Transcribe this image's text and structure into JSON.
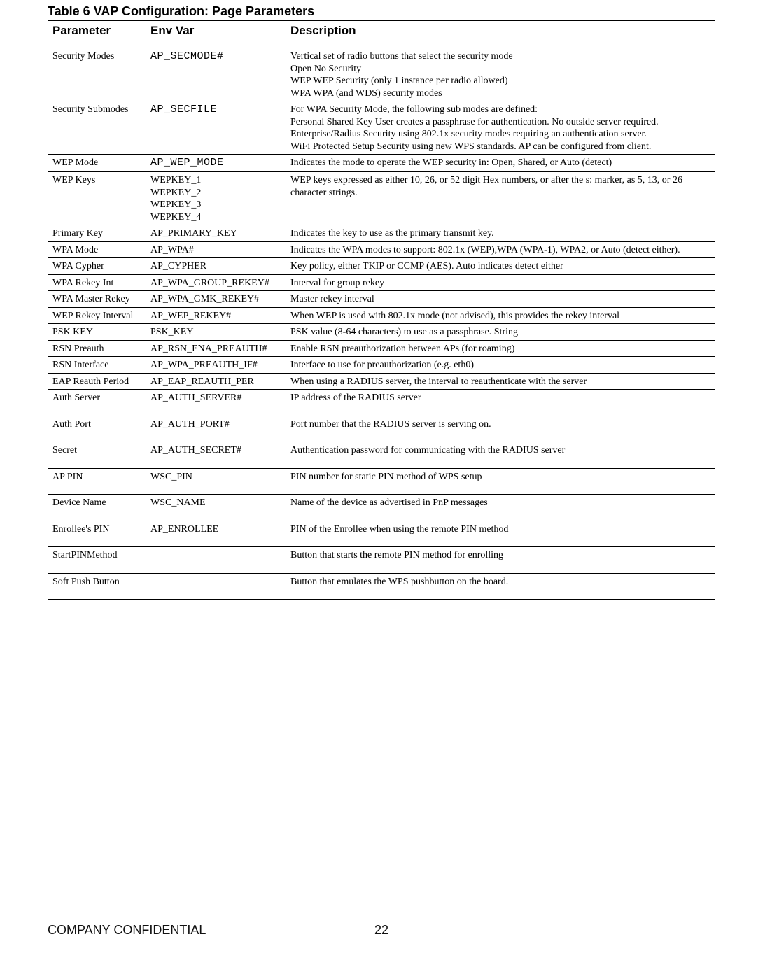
{
  "title": "Table 6 VAP Configuration: Page Parameters",
  "headers": {
    "param": "Parameter",
    "envvar": "Env Var",
    "desc": "Description"
  },
  "rows": [
    {
      "param": "Security Modes",
      "envvar": "AP_SECMODE#",
      "envmono": true,
      "desc": "Vertical set of radio buttons that select the security mode\nOpen No Security\nWEP WEP Security (only 1 instance per radio allowed)\nWPA WPA (and WDS) security modes"
    },
    {
      "param": "Security Submodes",
      "envvar": "AP_SECFILE",
      "envmono": true,
      "desc": "For WPA Security Mode, the following sub modes are defined:\nPersonal Shared Key User creates a passphrase for authentication. No outside server required.\nEnterprise/Radius Security using 802.1x security modes requiring an authentication server.\nWiFi Protected Setup Security using new WPS standards. AP can be configured from client."
    },
    {
      "param": "WEP Mode",
      "envvar": "AP_WEP_MODE",
      "envmono": true,
      "desc": "Indicates the mode to operate the WEP security in: Open, Shared, or Auto (detect)"
    },
    {
      "param": "WEP Keys",
      "envvar": "WEPKEY_1\nWEPKEY_2\nWEPKEY_3\nWEPKEY_4",
      "desc": "WEP keys expressed as either 10, 26, or 52 digit Hex numbers, or after the s: marker, as 5, 13, or 26 character strings."
    },
    {
      "param": "Primary Key",
      "envvar": "AP_PRIMARY_KEY",
      "desc": "Indicates the key to use as the primary transmit key."
    },
    {
      "param": "WPA Mode",
      "envvar": "AP_WPA#",
      "desc": "Indicates the WPA modes to support: 802.1x (WEP),WPA (WPA-1), WPA2, or Auto (detect either)."
    },
    {
      "param": "WPA Cypher",
      "envvar": "AP_CYPHER",
      "desc": "Key policy, either TKIP or CCMP (AES). Auto indicates detect either"
    },
    {
      "param": "WPA Rekey Int",
      "envvar": "AP_WPA_GROUP_REKEY#",
      "desc": "Interval for group rekey"
    },
    {
      "param": "WPA Master Rekey",
      "envvar": "AP_WPA_GMK_REKEY#",
      "desc": "Master rekey interval"
    },
    {
      "param": "WEP Rekey Interval",
      "envvar": "AP_WEP_REKEY#",
      "desc": "When WEP is used with 802.1x mode (not advised), this provides the rekey interval"
    },
    {
      "param": "PSK KEY",
      "envvar": "PSK_KEY",
      "desc": "PSK value (8-64 characters) to use as a passphrase. String"
    },
    {
      "param": "RSN Preauth",
      "envvar": "AP_RSN_ENA_PREAUTH#",
      "desc": "Enable RSN preauthorization between APs (for roaming)"
    },
    {
      "param": "RSN Interface",
      "envvar": "AP_WPA_PREAUTH_IF#",
      "desc": "Interface to use for preauthorization (e.g. eth0)"
    },
    {
      "param": "EAP Reauth Period",
      "envvar": "AP_EAP_REAUTH_PER",
      "desc": "When using a RADIUS server, the interval to reauthenticate with the server"
    },
    {
      "param": "Auth Server",
      "envvar": "AP_AUTH_SERVER#",
      "desc": "IP address of the RADIUS server",
      "pad": true
    },
    {
      "param": "Auth Port",
      "envvar": "AP_AUTH_PORT#",
      "desc": "Port number that the RADIUS server is serving on.",
      "pad": true
    },
    {
      "param": "Secret",
      "envvar": "AP_AUTH_SECRET#",
      "desc": "Authentication password for communicating with the RADIUS server",
      "pad": true
    },
    {
      "param": "AP PIN",
      "envvar": "WSC_PIN",
      "desc": "PIN number for static PIN method of WPS setup",
      "pad": true
    },
    {
      "param": "Device Name",
      "envvar": "WSC_NAME",
      "desc": "Name of the device as advertised in PnP messages",
      "pad": true
    },
    {
      "param": "Enrollee's PIN",
      "envvar": "AP_ENROLLEE",
      "desc": "PIN of the Enrollee when using the remote PIN method",
      "pad": true
    },
    {
      "param": "StartPINMethod",
      "envvar": "",
      "desc": "Button that starts the remote PIN method for enrolling",
      "pad": true
    },
    {
      "param": "Soft Push Button",
      "envvar": "",
      "desc": "Button that emulates the WPS pushbutton on the board.",
      "pad": true
    }
  ],
  "footer": {
    "left": "COMPANY CONFIDENTIAL",
    "page": "22"
  }
}
